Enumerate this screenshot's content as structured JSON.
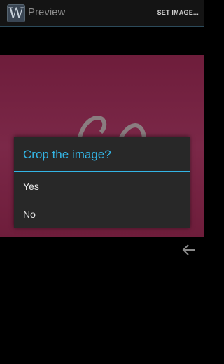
{
  "action_bar": {
    "app_icon_letter": "W",
    "title": "Preview",
    "set_image_label": "SET IMAGE..."
  },
  "dialog": {
    "title": "Crop the image?",
    "options": [
      {
        "label": "Yes"
      },
      {
        "label": "No"
      }
    ]
  },
  "icons": {
    "app_icon": "wallpaper-app-icon",
    "back": "back-arrow-icon"
  },
  "colors": {
    "accent": "#33b5e5",
    "dialog_bg": "#282828",
    "preview_bg": "#6e1d3b"
  }
}
